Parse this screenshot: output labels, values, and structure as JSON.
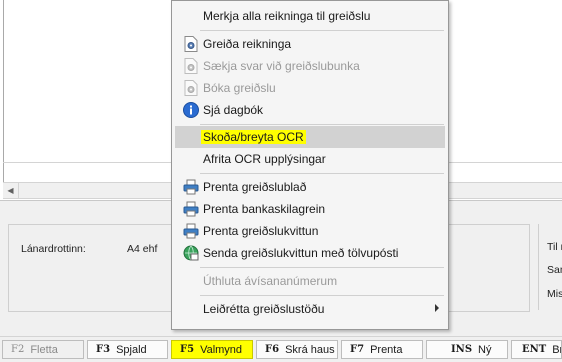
{
  "menu": {
    "items": [
      {
        "label": "Merkja alla reikninga til greiðslu",
        "disabled": false,
        "icon": "none"
      },
      {
        "label": "Greiða reikninga",
        "disabled": false,
        "icon": "gear-page-icon"
      },
      {
        "label": "Sækja svar við greiðslubunka",
        "disabled": true,
        "icon": "gear-page-icon"
      },
      {
        "label": "Bóka greiðslu",
        "disabled": true,
        "icon": "gear-page-icon"
      },
      {
        "label": "Sjá dagbók",
        "disabled": false,
        "icon": "info-icon"
      },
      {
        "label": "Skoða/breyta OCR",
        "disabled": false,
        "highlighted": true,
        "icon": "none"
      },
      {
        "label": "Afrita OCR upplýsingar",
        "disabled": false,
        "icon": "none"
      },
      {
        "label": "Prenta greiðslublað",
        "disabled": false,
        "icon": "print-icon"
      },
      {
        "label": "Prenta bankaskilagrein",
        "disabled": false,
        "icon": "print-icon"
      },
      {
        "label": "Prenta greiðslukvittun",
        "disabled": false,
        "icon": "print-icon"
      },
      {
        "label": "Senda greiðslukvittun með tölvupósti",
        "disabled": false,
        "icon": "email-globe-icon"
      },
      {
        "label": "Úthluta ávísananúmerum",
        "disabled": true,
        "icon": "none"
      },
      {
        "label": "Leiðrétta greiðslustöðu",
        "disabled": false,
        "icon": "none",
        "submenu": true
      }
    ]
  },
  "info": {
    "creditor_label": "Lánardrottinn:",
    "creditor_value": "A4 ehf",
    "right_1": "Til r",
    "right_2": "Sam",
    "right_3": "Mis"
  },
  "fkeys": [
    {
      "key": "F2",
      "label": "Fletta",
      "state": "disabled"
    },
    {
      "key": "F3",
      "label": "Spjald",
      "state": "normal"
    },
    {
      "key": "F5",
      "label": "Valmynd",
      "state": "active"
    },
    {
      "key": "F6",
      "label": "Skrá haus",
      "state": "normal"
    },
    {
      "key": "F7",
      "label": "Prenta",
      "state": "normal"
    },
    {
      "key": "INS",
      "label": "Ný",
      "state": "normal"
    },
    {
      "key": "ENT",
      "label": "Bre",
      "state": "normal"
    }
  ],
  "colors": {
    "highlight": "#ffff00",
    "info_blue": "#2a6bd1"
  }
}
